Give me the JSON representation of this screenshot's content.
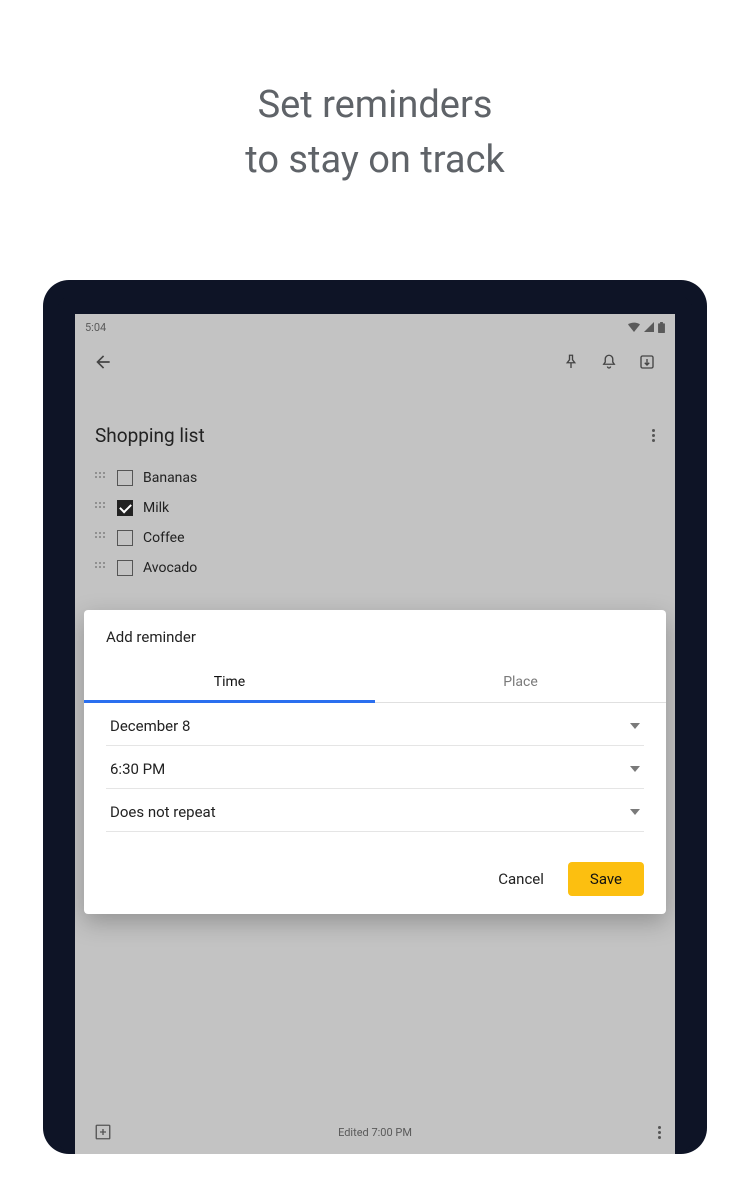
{
  "promo": {
    "line1": "Set reminders",
    "line2": "to stay on track"
  },
  "status": {
    "time": "5:04"
  },
  "note": {
    "title": "Shopping list",
    "items": [
      {
        "label": "Bananas",
        "checked": false
      },
      {
        "label": "Milk",
        "checked": true
      },
      {
        "label": "Coffee",
        "checked": false
      },
      {
        "label": "Avocado",
        "checked": false
      }
    ]
  },
  "reminder_dialog": {
    "title": "Add reminder",
    "tabs": {
      "time": "Time",
      "place": "Place"
    },
    "date": "December 8",
    "time": "6:30 PM",
    "repeat": "Does not repeat",
    "cancel": "Cancel",
    "save": "Save"
  },
  "bottom": {
    "edited": "Edited 7:00 PM"
  }
}
